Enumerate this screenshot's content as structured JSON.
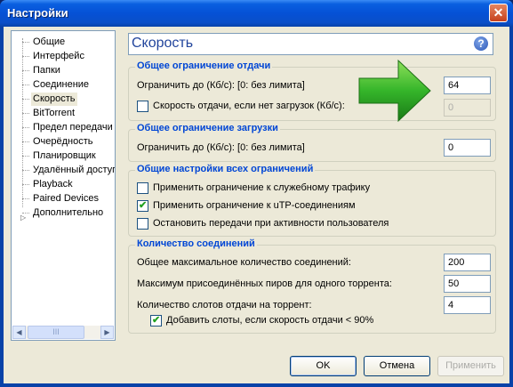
{
  "window": {
    "title": "Настройки"
  },
  "tree": {
    "items": [
      {
        "label": "Общие"
      },
      {
        "label": "Интерфейс"
      },
      {
        "label": "Папки"
      },
      {
        "label": "Соединение"
      },
      {
        "label": "Скорость",
        "selected": true
      },
      {
        "label": "BitTorrent"
      },
      {
        "label": "Предел передачи"
      },
      {
        "label": "Очерёдность"
      },
      {
        "label": "Планировщик"
      },
      {
        "label": "Удалённый доступ"
      },
      {
        "label": "Playback"
      },
      {
        "label": "Paired Devices"
      },
      {
        "label": "Дополнительно"
      }
    ]
  },
  "panel": {
    "title": "Скорость"
  },
  "upload_group": {
    "title": "Общее ограничение отдачи",
    "limit_label": "Ограничить до (Кб/с): [0: без лимита]",
    "limit_value": "64",
    "idle_checkbox_label": "Скорость отдачи, если нет загрузок (Кб/с):",
    "idle_checked": false,
    "idle_value": "0"
  },
  "download_group": {
    "title": "Общее ограничение загрузки",
    "limit_label": "Ограничить до (Кб/с): [0: без лимита]",
    "limit_value": "0"
  },
  "global_group": {
    "title": "Общие настройки всех ограничений",
    "options": [
      {
        "label": "Применить ограничение к служебному трафику",
        "checked": false
      },
      {
        "label": "Применить ограничение к uTP-соединениям",
        "checked": true
      },
      {
        "label": "Остановить передачи при активности пользователя",
        "checked": false
      }
    ]
  },
  "connections_group": {
    "title": "Количество соединений",
    "max_connections_label": "Общее максимальное количество соединений:",
    "max_connections_value": "200",
    "max_peers_label": "Максимум присоединённых пиров для одного торрента:",
    "max_peers_value": "50",
    "upload_slots_label": "Количество слотов отдачи на торрент:",
    "upload_slots_value": "4",
    "add_slots_label": "Добавить слоты, если скорость отдачи < 90%",
    "add_slots_checked": true
  },
  "buttons": {
    "ok": "OK",
    "cancel": "Отмена",
    "apply": "Применить"
  },
  "colors": {
    "group_title": "#0046d5",
    "header_title": "#21449c",
    "arrow": "#2eb82e"
  },
  "icons": {
    "help": "help-icon",
    "close": "close-icon",
    "arrow": "green-arrow-icon"
  }
}
